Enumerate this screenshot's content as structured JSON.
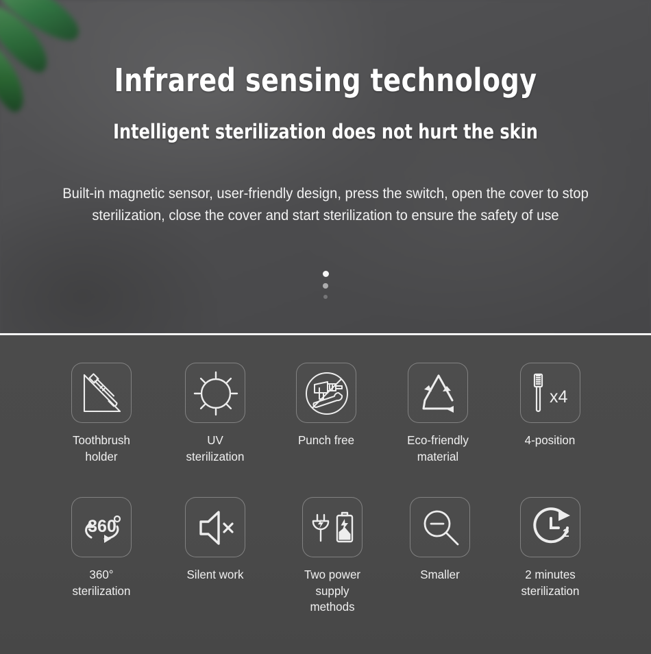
{
  "hero": {
    "title": "Infrared sensing technology",
    "subtitle": "Intelligent sterilization does not hurt the skin",
    "body": "Built-in magnetic sensor, user-friendly design, press the switch, open the cover to stop sterilization, close the cover and start sterilization to ensure the safety of use",
    "scroll_hint_dots": 3,
    "background_color": "#4d4d4f",
    "text_color": "#ffffff"
  },
  "divider": {
    "color": "#f4f4f4"
  },
  "features": {
    "background_color": "#4a4a4a",
    "tile_border_color": "rgba(255,255,255,0.30)",
    "row1": [
      {
        "icon": "toothbrush-holder-icon",
        "label": "Toothbrush holder"
      },
      {
        "icon": "uv-sun-icon",
        "label": "UV sterilization"
      },
      {
        "icon": "no-drill-punch-free-icon",
        "label": "Punch free"
      },
      {
        "icon": "recycle-icon",
        "label": "Eco-friendly material"
      },
      {
        "icon": "toothbrush-x4-icon",
        "label": "4-position"
      }
    ],
    "row2": [
      {
        "icon": "360-degree-icon",
        "label": "360° sterilization"
      },
      {
        "icon": "mute-speaker-icon",
        "label": "Silent work"
      },
      {
        "icon": "plug-battery-icon",
        "label": "Two power\nsupply methods"
      },
      {
        "icon": "magnifier-minus-icon",
        "label": "Smaller"
      },
      {
        "icon": "clock-timer-2-icon",
        "label": "2 minutes\nsterilization"
      }
    ]
  }
}
